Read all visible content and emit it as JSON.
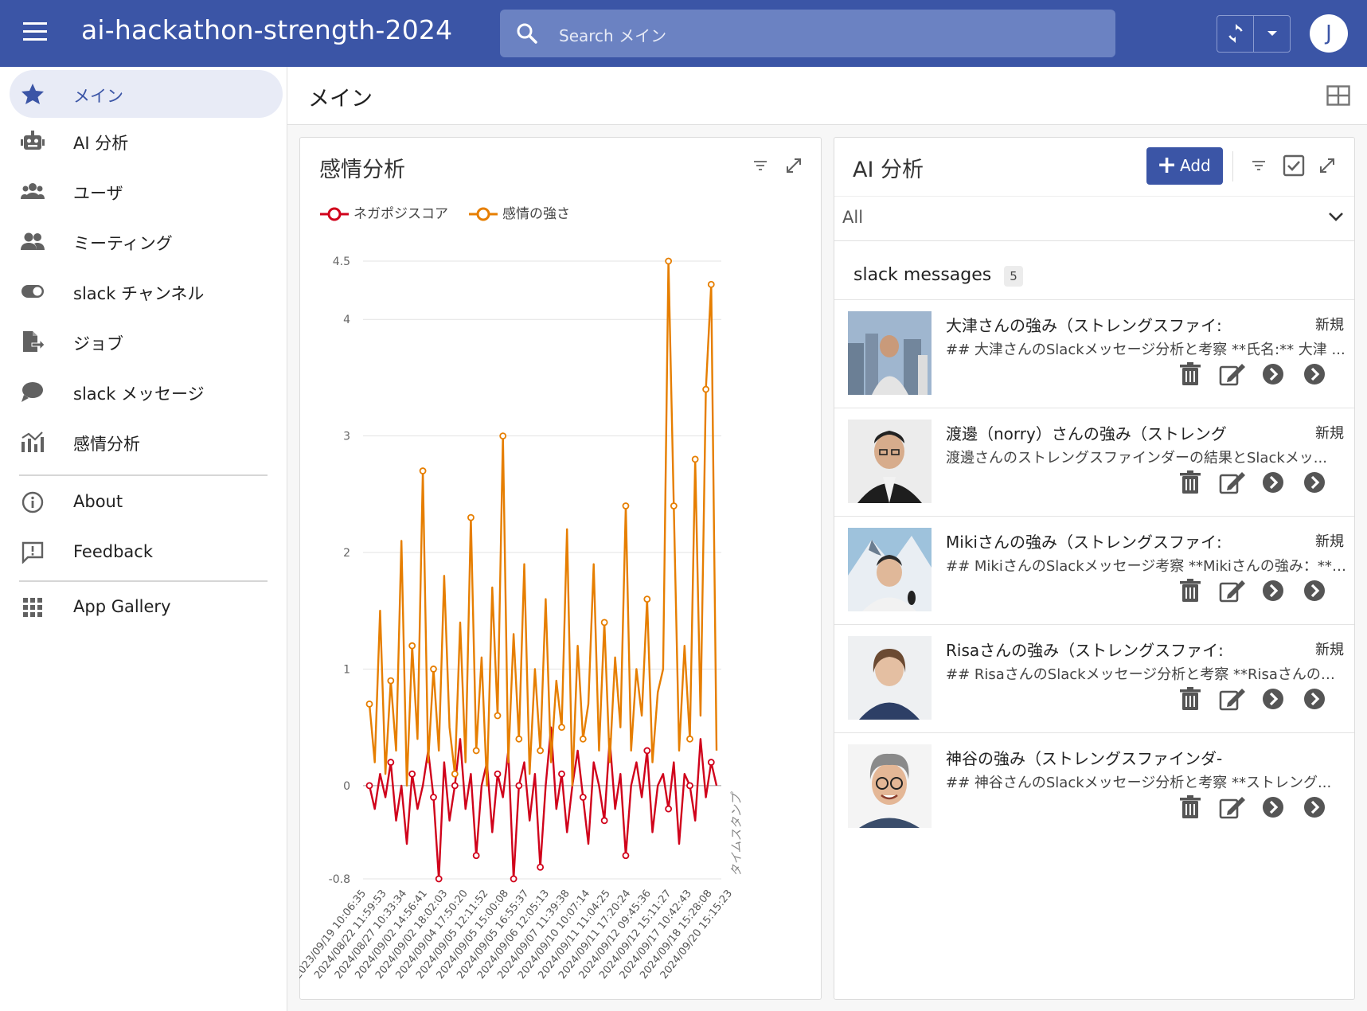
{
  "app": {
    "title": "ai-hackathon-strength-2024",
    "search_placeholder": "Search メイン",
    "user_initial": "J",
    "accent_color": "#3b55a6"
  },
  "sidebar": {
    "items": [
      {
        "label": "メイン",
        "icon": "star-icon",
        "active": true
      },
      {
        "label": "AI 分析",
        "icon": "robot-icon"
      },
      {
        "label": "ユーザ",
        "icon": "group-icon"
      },
      {
        "label": "ミーティング",
        "icon": "people-icon"
      },
      {
        "label": "slack チャンネル",
        "icon": "toggle-icon"
      },
      {
        "label": "ジョブ",
        "icon": "file-export-icon"
      },
      {
        "label": "slack メッセージ",
        "icon": "chat-bubble-icon"
      },
      {
        "label": "感情分析",
        "icon": "analytics-icon"
      }
    ],
    "secondary": [
      {
        "label": "About",
        "icon": "info-icon"
      },
      {
        "label": "Feedback",
        "icon": "feedback-icon"
      }
    ],
    "tertiary": [
      {
        "label": "App Gallery",
        "icon": "apps-grid-icon"
      }
    ]
  },
  "main": {
    "title": "メイン"
  },
  "sentiment_card": {
    "title": "感情分析",
    "legend": [
      {
        "name": "ネガポジスコア",
        "color": "#d0021b"
      },
      {
        "name": "感情の強さ",
        "color": "#e67e00"
      }
    ],
    "x_axis_title": "タイムスタンプ"
  },
  "chart_data": {
    "type": "line",
    "ylim": [
      -0.8,
      4.5
    ],
    "yticks": [
      "4.5",
      "4",
      "3",
      "2",
      "1",
      "0",
      "-0.8"
    ],
    "x_tick_labels": [
      "2023/09/19 10:06:35",
      "2024/08/22 11:59:53",
      "2024/08/27 10:33:34",
      "2024/09/02 14:56:41",
      "2024/09/02 18:02:03",
      "2024/09/04 17:50:20",
      "2024/09/05 12:11:52",
      "2024/09/05 15:00:08",
      "2024/09/05 16:55:37",
      "2024/09/06 12:05:13",
      "2024/09/07 11:39:38",
      "2024/09/10 10:07:14",
      "2024/09/11 11:04:25",
      "2024/09/11 17:20:24",
      "2024/09/12 09:45:36",
      "2024/09/12 15:11:27",
      "2024/09/17 10:42:43",
      "2024/09/18 15:28:08",
      "2024/09/20 15:15:23"
    ],
    "series": [
      {
        "name": "ネガポジスコア",
        "color": "#d0021b",
        "values": [
          0.0,
          -0.2,
          0.1,
          -0.1,
          0.2,
          -0.3,
          0.0,
          -0.5,
          0.1,
          -0.2,
          0.0,
          0.3,
          -0.1,
          -0.8,
          0.2,
          -0.3,
          0.0,
          0.4,
          -0.2,
          0.1,
          -0.6,
          0.0,
          0.2,
          -0.4,
          0.1,
          -0.1,
          0.3,
          -0.8,
          0.0,
          0.2,
          -0.3,
          0.1,
          -0.7,
          0.0,
          0.5,
          -0.2,
          0.1,
          -0.4,
          0.0,
          0.3,
          -0.1,
          -0.5,
          0.2,
          0.0,
          -0.3,
          0.4,
          -0.2,
          0.1,
          -0.6,
          0.0,
          0.2,
          -0.1,
          0.3,
          -0.4,
          0.0,
          0.1,
          -0.2,
          0.2,
          -0.5,
          0.1,
          0.0,
          -0.3,
          0.4,
          -0.1,
          0.2,
          0.0
        ]
      },
      {
        "name": "感情の強さ",
        "color": "#e67e00",
        "values": [
          0.7,
          0.2,
          1.5,
          0.1,
          0.9,
          0.3,
          2.1,
          0.0,
          1.2,
          0.4,
          2.7,
          0.2,
          1.0,
          0.3,
          1.8,
          0.5,
          0.1,
          1.4,
          0.2,
          2.3,
          0.3,
          1.1,
          0.0,
          1.7,
          0.6,
          3.0,
          0.2,
          1.3,
          0.4,
          1.9,
          0.1,
          1.0,
          0.3,
          1.6,
          0.2,
          0.9,
          0.5,
          2.2,
          0.0,
          1.2,
          0.4,
          0.7,
          1.9,
          0.3,
          1.4,
          0.2,
          1.1,
          0.5,
          2.4,
          0.3,
          1.0,
          0.6,
          1.6,
          0.2,
          0.8,
          1.0,
          4.5,
          2.4,
          0.3,
          1.2,
          0.4,
          2.8,
          0.6,
          3.4,
          4.3,
          0.3
        ]
      }
    ]
  },
  "ai_card": {
    "title": "AI 分析",
    "add_label": "Add",
    "filter_value": "All",
    "group_title": "slack messages",
    "group_count": "5",
    "rows": [
      {
        "title": "大津さんの強み（ストレングスファイ:",
        "badge": "新規",
        "desc": "## 大津さんのSlackメッセージ分析と考察 **氏名:** 大津 ...",
        "thumb": "city"
      },
      {
        "title": "渡邊（norry）さんの強み（ストレング",
        "badge": "新規",
        "desc": "渡邊さんのストレングスファインダーの結果とSlackメッ...",
        "thumb": "office"
      },
      {
        "title": "Mikiさんの強み（ストレングスファイ:",
        "badge": "新規",
        "desc": "## MikiさんのSlackメッセージ考察 **Mikiさんの強み：** ...",
        "thumb": "mountain"
      },
      {
        "title": "Risaさんの強み（ストレングスファイ:",
        "badge": "新規",
        "desc": "## RisaさんのSlackメッセージ分析と考察 **Risaさんのス...",
        "thumb": "plain"
      },
      {
        "title": "神谷の強み（ストレングスファインダ-",
        "badge": "",
        "desc": "## 神谷さんのSlackメッセージ分析と考察 **ストレング...",
        "thumb": "portrait"
      }
    ]
  }
}
